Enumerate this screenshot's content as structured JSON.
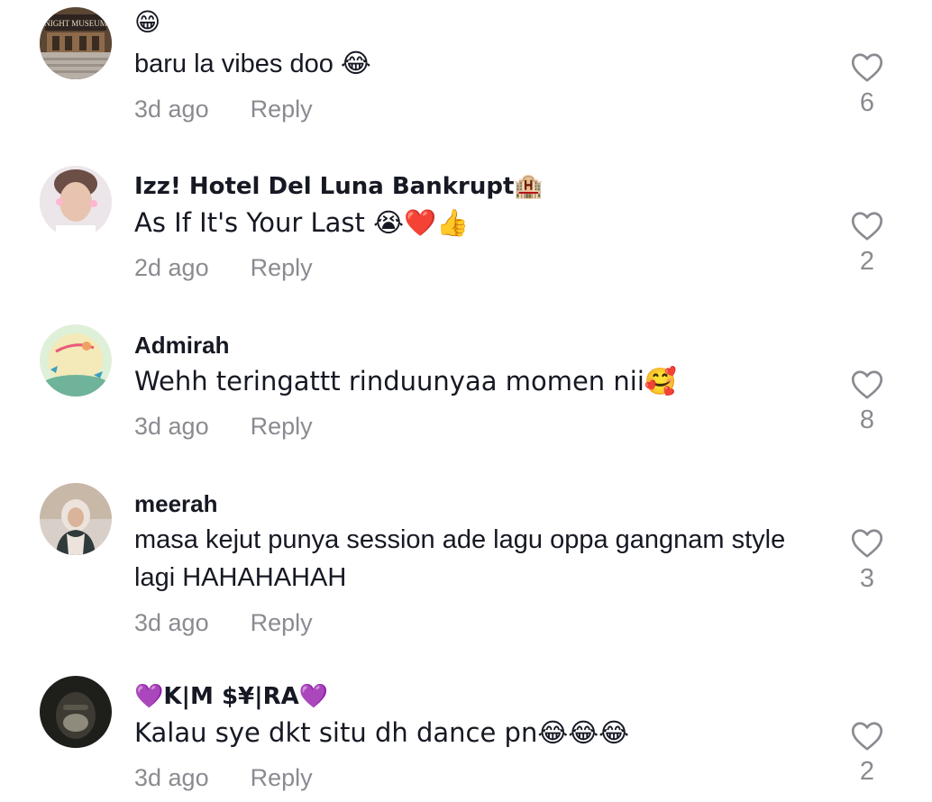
{
  "comments": [
    {
      "username": "😁",
      "text": "baru la vibes doo 😂",
      "time": "3d ago",
      "reply": "Reply",
      "likes": "6",
      "avatar": "night-museum-avatar"
    },
    {
      "username": "Izz! Hotel Del Luna Bankrupt🏨",
      "text": "As If It's Your Last 😭❤️👍",
      "time": "2d ago",
      "reply": "Reply",
      "likes": "2",
      "avatar": "person-avatar"
    },
    {
      "username": "Admirah",
      "text": "Wehh teringattt rinduunyaa momen nii🥰",
      "time": "3d ago",
      "reply": "Reply",
      "likes": "8",
      "avatar": "illustration-avatar"
    },
    {
      "username": "meerah",
      "text": "masa kejut punya session ade lagu oppa gangnam style lagi HAHAHAHAH",
      "time": "3d ago",
      "reply": "Reply",
      "likes": "3",
      "avatar": "hijab-avatar"
    },
    {
      "username": "💜K|M $¥|RA💜",
      "text": "Kalau sye dkt situ dh dance pn😂😂😂",
      "time": "3d ago",
      "reply": "Reply",
      "likes": "2",
      "avatar": "masked-avatar"
    }
  ],
  "colors": {
    "text": "#161823",
    "secondary": "#8a8b91"
  },
  "icons": {
    "like": "heart-outline-icon"
  }
}
